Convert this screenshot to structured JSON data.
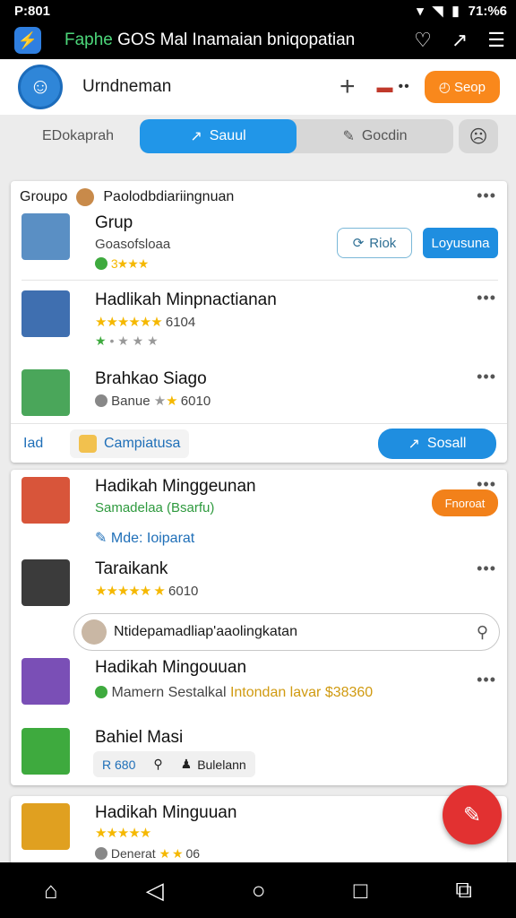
{
  "status_bar": {
    "time_left": "P:801",
    "time_right": "71:%6"
  },
  "app_bar": {
    "title_accent": "Faphe",
    "title_rest": " GOS Mal Inamaian bniqopatian"
  },
  "profile": {
    "name": "Urndneman",
    "orange_button": "Seop"
  },
  "tabs": {
    "left_label": "EDokaprah",
    "active_label": "Sauul",
    "inactive_label": "Gocdin"
  },
  "group1": {
    "label": "Groupo",
    "header": "Paolodbdiariingnuan",
    "items": [
      {
        "title": "Grup",
        "sub": "Goasofsloaa",
        "sub2": "3★★★"
      },
      {
        "title": "Hadlikah Minpnactianan",
        "sub": "6104",
        "sub2": ""
      },
      {
        "title": "Brahkao Siago",
        "sub": "Banue",
        "sub2": "6010"
      }
    ],
    "outline_button": "Riok",
    "blue_button": "Loyusuna",
    "foot_left": "Iad",
    "foot_mid": "Campiatusa",
    "foot_button": "Sosall"
  },
  "group2": {
    "items": [
      {
        "title": "Hadikah Minggeunan",
        "sub": "Samadelaa (Bsarfu)",
        "sub2": "Mde: Ioiparat"
      },
      {
        "title": "Taraikank",
        "sub": "6010"
      },
      {
        "title": "Hadikah Mingouuan",
        "sub_a": "Mamern Sestalkal",
        "sub_b": "Intondan lavar",
        "sub_c": "$38360"
      },
      {
        "title": "Bahiel Masi",
        "chip1": "R 680",
        "chip2": "Bulelann"
      }
    ],
    "orange_badge": "Fnoroat",
    "search_text": "Ntidepamadliap'aaolingkatan"
  },
  "group3": {
    "items": [
      {
        "title": "Hadikah Minguuan",
        "sub": "Denerat",
        "sub2": "06"
      }
    ]
  },
  "colors": {
    "accent_blue": "#1f8ee0",
    "accent_orange": "#f9881c",
    "fab_red": "#e23131"
  }
}
